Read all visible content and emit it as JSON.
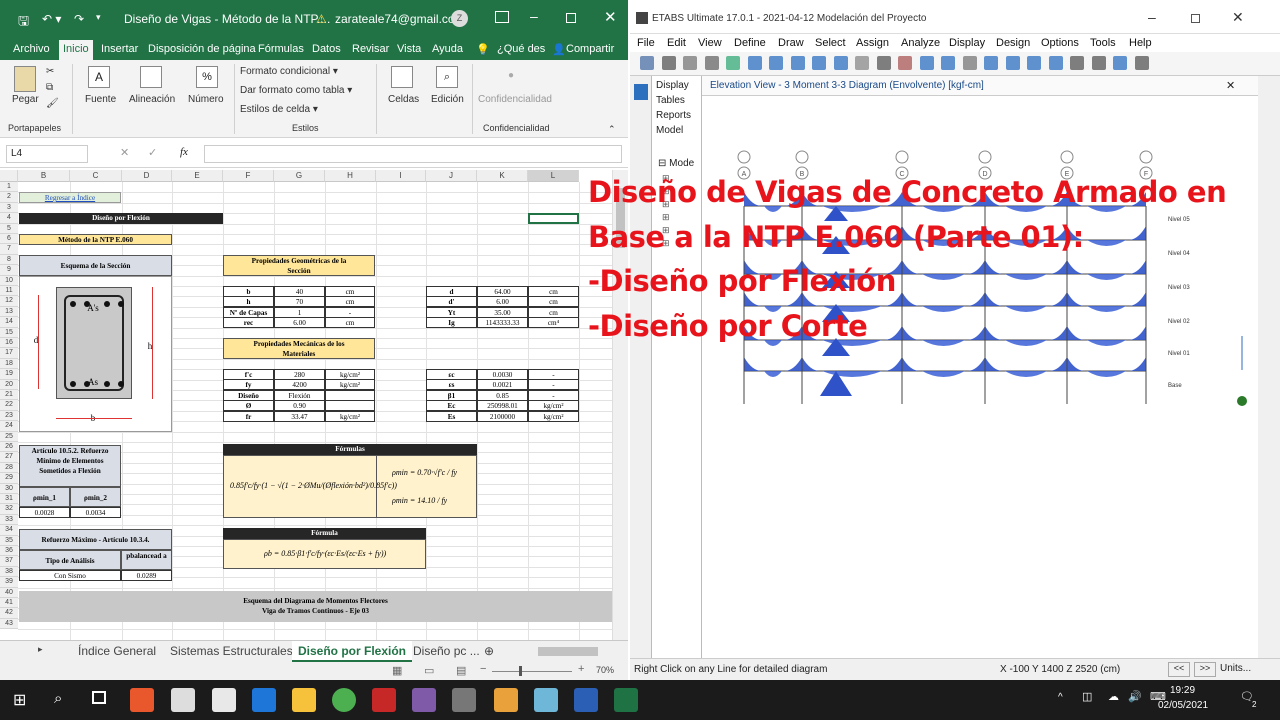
{
  "excel": {
    "title": "Diseño de Vigas - Método de la NTP....",
    "warning": "⚠",
    "account": "zarateale74@gmail.com",
    "avatar": "Z",
    "menu": [
      "Archivo",
      "Inicio",
      "Insertar",
      "Disposición de página",
      "Fórmulas",
      "Datos",
      "Revisar",
      "Vista",
      "Ayuda",
      "¿Qué des",
      "Compartir"
    ],
    "ribbon": {
      "pegar": "Pegar",
      "fuente": "Fuente",
      "alineacion": "Alineación",
      "numero": "Número",
      "formato_condicional": "Formato condicional ▾",
      "dar_formato": "Dar formato como tabla ▾",
      "estilos_celda": "Estilos de celda ▾",
      "celdas": "Celdas",
      "edicion": "Edición",
      "confidencialidad": "Confidencialidad",
      "g_portapapeles": "Portapapeles",
      "g_estilos": "Estilos",
      "g_confidencialidad": "Confidencialidad"
    },
    "namebox": "L4",
    "fx": "fx",
    "columns": [
      "B",
      "C",
      "D",
      "E",
      "F",
      "G",
      "H",
      "I",
      "J",
      "K",
      "L"
    ],
    "rows": [
      "1",
      "2",
      "3",
      "4",
      "5",
      "6",
      "7",
      "8",
      "9",
      "10",
      "11",
      "12",
      "13",
      "14",
      "15",
      "16",
      "17",
      "18",
      "19",
      "20",
      "21",
      "22",
      "23",
      "24",
      "25",
      "26",
      "27",
      "28",
      "29",
      "30",
      "31",
      "32",
      "33",
      "34",
      "35",
      "36",
      "37",
      "38",
      "39",
      "40",
      "41",
      "42",
      "43"
    ],
    "cells": {
      "regresar": "Regresar a Índice",
      "diseno_flexion": "Diseño por Flexión",
      "metodo": "Método de la NTP E.060",
      "esquema": "Esquema de la Sección",
      "as_top": "A's",
      "as_bot": "As",
      "lbl_d": "d",
      "lbl_h": "h",
      "lbl_b": "b",
      "prop_geo": "Propiedades Geométricas de la Sección",
      "geo": [
        [
          "b",
          "40",
          "cm"
        ],
        [
          "h",
          "70",
          "cm"
        ],
        [
          "Nº de Capas",
          "1",
          "-"
        ],
        [
          "rec",
          "6.00",
          "cm"
        ]
      ],
      "geo2": [
        [
          "d",
          "64.00",
          "cm"
        ],
        [
          "d'",
          "6.00",
          "cm"
        ],
        [
          "Yt",
          "35.00",
          "cm"
        ],
        [
          "Ig",
          "1143333.33",
          "cm⁴"
        ]
      ],
      "prop_mec": "Propiedades Mecánicas de los Materiales",
      "mec": [
        [
          "f'c",
          "280",
          "kg/cm²"
        ],
        [
          "fy",
          "4200",
          "kg/cm²"
        ],
        [
          "Diseño",
          "Flexión",
          ""
        ],
        [
          "Ø",
          "0.90",
          ""
        ],
        [
          "fr",
          "33.47",
          "kg/cm²"
        ]
      ],
      "mec2": [
        [
          "εc",
          "0.0030",
          "-"
        ],
        [
          "εs",
          "0.0021",
          "-"
        ],
        [
          "β1",
          "0.85",
          "-"
        ],
        [
          "Ec",
          "250998.01",
          "kg/cm²"
        ],
        [
          "Es",
          "2100000",
          "kg/cm²"
        ]
      ],
      "art1": "Artículo 10.5.2. Refuerzo Mínimo de Elementos Sometidos a Flexión",
      "pmin1": "ρmin_1",
      "pmin2": "ρmin_2",
      "v_pmin1": "0.0028",
      "v_pmin2": "0.0034",
      "formulas": "Fórmulas",
      "formula": "Fórmula",
      "art2": "Refuerzo Máximo - Artículo 10.3.4.",
      "tipo": "Tipo de Análisis",
      "pbal": "pbalancead a",
      "sismo": "Con Sismo",
      "v_pbal": "0.0289",
      "esq_diag": "Esquema del Diagrama de Momentos Flectores",
      "viga": "Viga de Tramos Continuos - Eje 03"
    },
    "tabs": [
      "Índice General",
      "Sistemas Estructurales",
      "Diseño por Flexión",
      "Diseño pc ..."
    ],
    "zoom": "70%"
  },
  "etabs": {
    "title": "ETABS Ultimate 17.0.1 - 2021-04-12 Modelación del Proyecto",
    "menu": [
      "File",
      "Edit",
      "View",
      "Define",
      "Draw",
      "Select",
      "Assign",
      "Analyze",
      "Display",
      "Design",
      "Options",
      "Tools",
      "Help"
    ],
    "panel": [
      "Display",
      "Tables",
      "Reports",
      "Model"
    ],
    "tree": "Mode",
    "view_tab": "Elevation View - 3   Moment 3-3 Diagram   (Envolvente)  [kgf-cm]",
    "levels": [
      "Nivel 05",
      "Nivel 04",
      "Nivel 03",
      "Nivel 02",
      "Nivel 01",
      "Base"
    ],
    "axes": [
      "A",
      "B",
      "C",
      "D",
      "E",
      "F"
    ],
    "status_left": "Right Click on any Line for detailed diagram",
    "coords": "X -100  Y 1400  Z 2520 (cm)",
    "units": "Units..."
  },
  "overlay": [
    "Diseño de Vigas de Concreto Armado en",
    "Base a la NTP E.060 (Parte 01):",
    "-Diseño por Flexión",
    "-Diseño por Corte"
  ],
  "taskbar": {
    "time": "19:29",
    "date": "02/05/2021",
    "notif": "2"
  }
}
